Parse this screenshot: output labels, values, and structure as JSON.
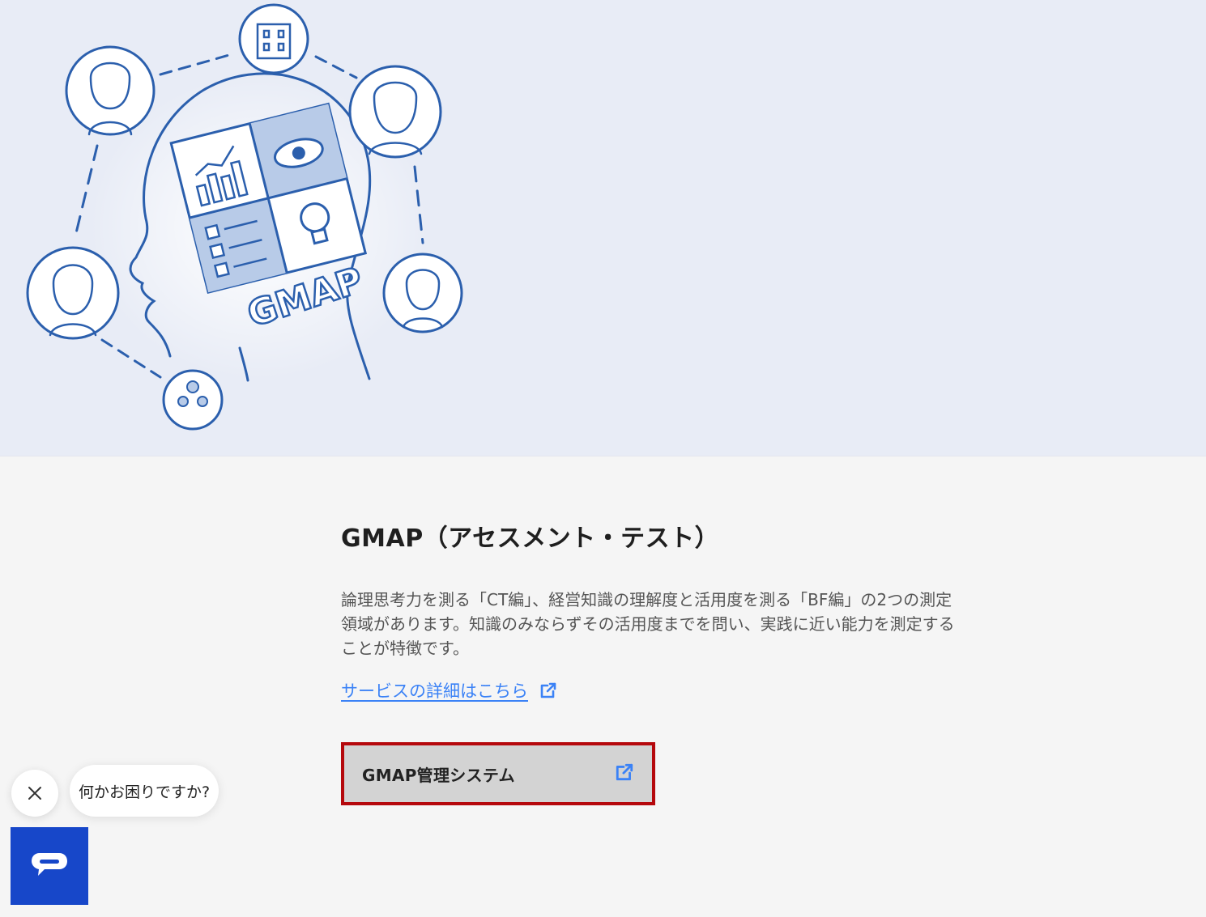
{
  "hero": {
    "illustration": "gmap-head-network-illustration",
    "logo_text": "GMAP"
  },
  "service": {
    "title": "GMAP（アセスメント・テスト）",
    "description_lines": [
      "論理思考力を測る「CT編」、経営知識の理解度と活用度を測る「BF編」の2つの測定",
      "領域があります。知識のみならずその活用度までを問い、実践に近い能力を測定する",
      "ことが特徴です。"
    ],
    "detail_link": "サービスの詳細はこちら",
    "system_button": "GMAP管理システム",
    "link_icon": "external-link-icon"
  },
  "chat": {
    "prompt": "何かお困りですか?",
    "close_icon": "close-icon",
    "open_icon": "chat-bubble-icon"
  },
  "colors": {
    "hero_bg": "#e8ecf6",
    "page_bg": "#f5f5f5",
    "link": "#3b82f6",
    "highlight_border": "#b5080c",
    "chat_button": "#1747c9",
    "illustration_stroke": "#2b5fad"
  }
}
